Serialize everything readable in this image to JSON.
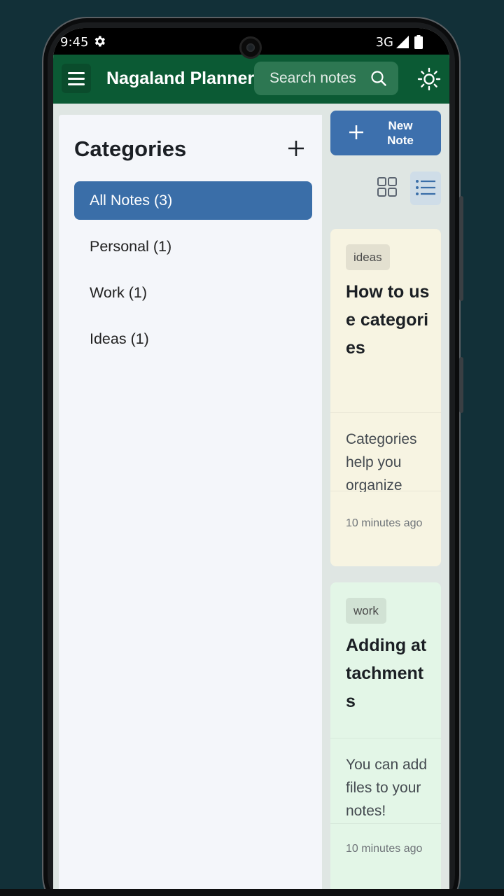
{
  "status_bar": {
    "time": "9:45",
    "network": "3G"
  },
  "app_bar": {
    "title": "Nagaland Planner",
    "search_placeholder": "Search notes"
  },
  "sidebar": {
    "title": "Categories",
    "items": [
      {
        "label": "All Notes (3)",
        "active": true
      },
      {
        "label": "Personal (1)",
        "active": false
      },
      {
        "label": "Work (1)",
        "active": false
      },
      {
        "label": "Ideas (1)",
        "active": false
      }
    ]
  },
  "toolbar": {
    "new_note_label_1": "New",
    "new_note_label_2": "Note"
  },
  "notes": [
    {
      "tag": "ideas",
      "title": "How to use categories",
      "body": "Categories help you organize",
      "time": "10 minutes ago",
      "color": "#f7f4e2"
    },
    {
      "tag": "work",
      "title": "Adding attachments",
      "body": "You can add files to your notes!",
      "time": "10 minutes ago",
      "color": "#e3f6e7"
    }
  ],
  "colors": {
    "app_bar": "#0b5a34",
    "accent": "#3a6ea8",
    "background": "#123038"
  }
}
